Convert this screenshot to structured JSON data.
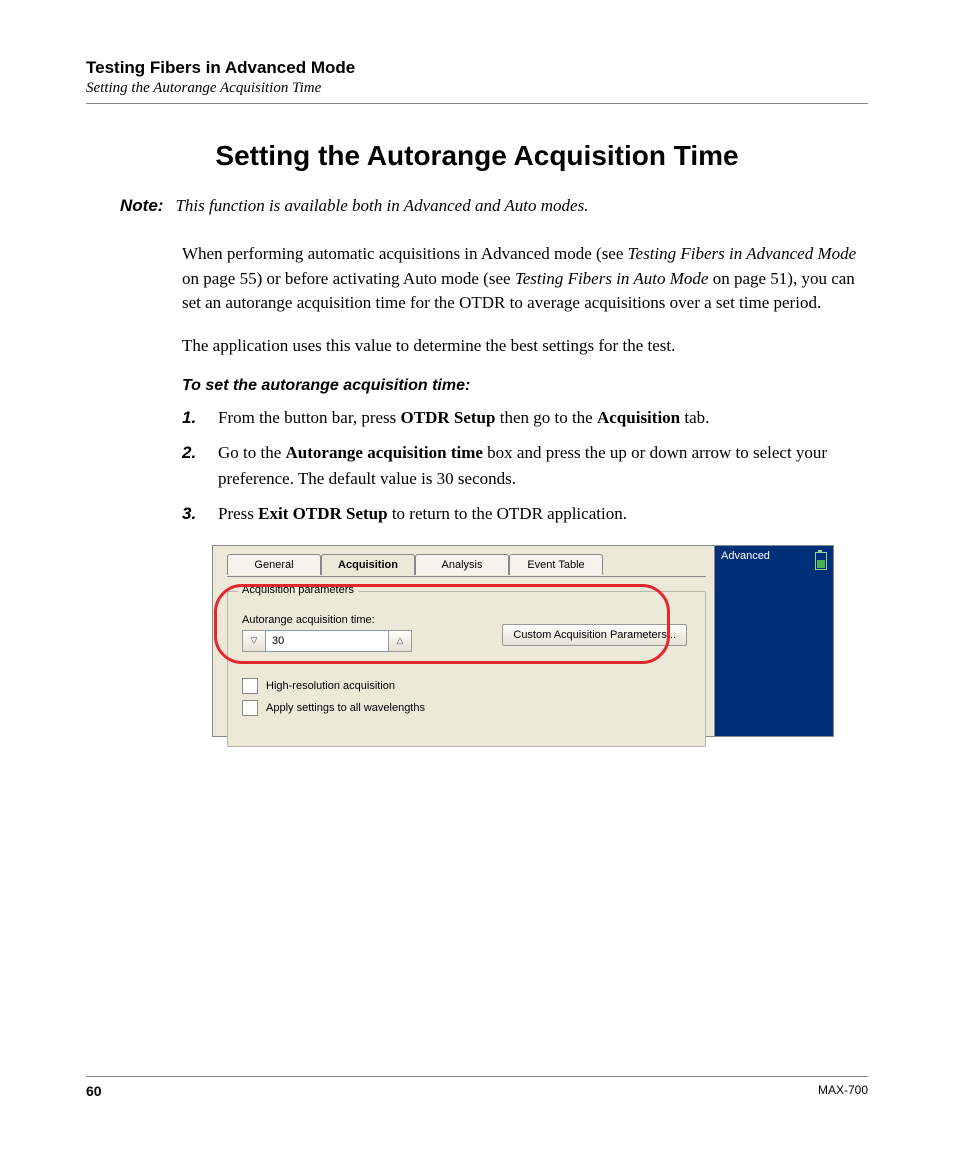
{
  "header": {
    "chapter": "Testing Fibers in Advanced Mode",
    "section": "Setting the Autorange Acquisition Time"
  },
  "title": "Setting the Autorange Acquisition Time",
  "note": {
    "label": "Note:",
    "text": "This function is available both in Advanced and Auto modes."
  },
  "para1": {
    "a": "When performing automatic acquisitions in Advanced mode (see ",
    "i1": "Testing Fibers in Advanced Mode",
    "b": " on page 55) or before activating Auto mode (see ",
    "i2": "Testing Fibers in Auto Mode",
    "c": " on page 51), you can set an autorange acquisition time for the OTDR to average acquisitions over a set time period."
  },
  "para2": "The application uses this value to determine the best settings for the test.",
  "subhead": "To set the autorange acquisition time:",
  "steps": {
    "s1a": "From the button bar, press ",
    "s1b": "OTDR Setup",
    "s1c": " then go to the ",
    "s1d": "Acquisition",
    "s1e": " tab.",
    "s2a": "Go to the ",
    "s2b": "Autorange acquisition time",
    "s2c": " box and press the up or down arrow to select your preference. The default value is 30 seconds.",
    "s3a": "Press ",
    "s3b": "Exit OTDR Setup",
    "s3c": " to return to the OTDR application."
  },
  "shot": {
    "tabs": {
      "general": "General",
      "acquisition": "Acquisition",
      "analysis": "Analysis",
      "event_table": "Event Table"
    },
    "fieldset_legend": "Acquisition parameters",
    "param_label": "Autorange acquisition time:",
    "param_value": "30",
    "custom_btn": "Custom Acquisition Parameters...",
    "chk1": "High-resolution acquisition",
    "chk2": "Apply settings to all wavelengths",
    "side_label": "Advanced"
  },
  "footer": {
    "page": "60",
    "model": "MAX-700"
  }
}
